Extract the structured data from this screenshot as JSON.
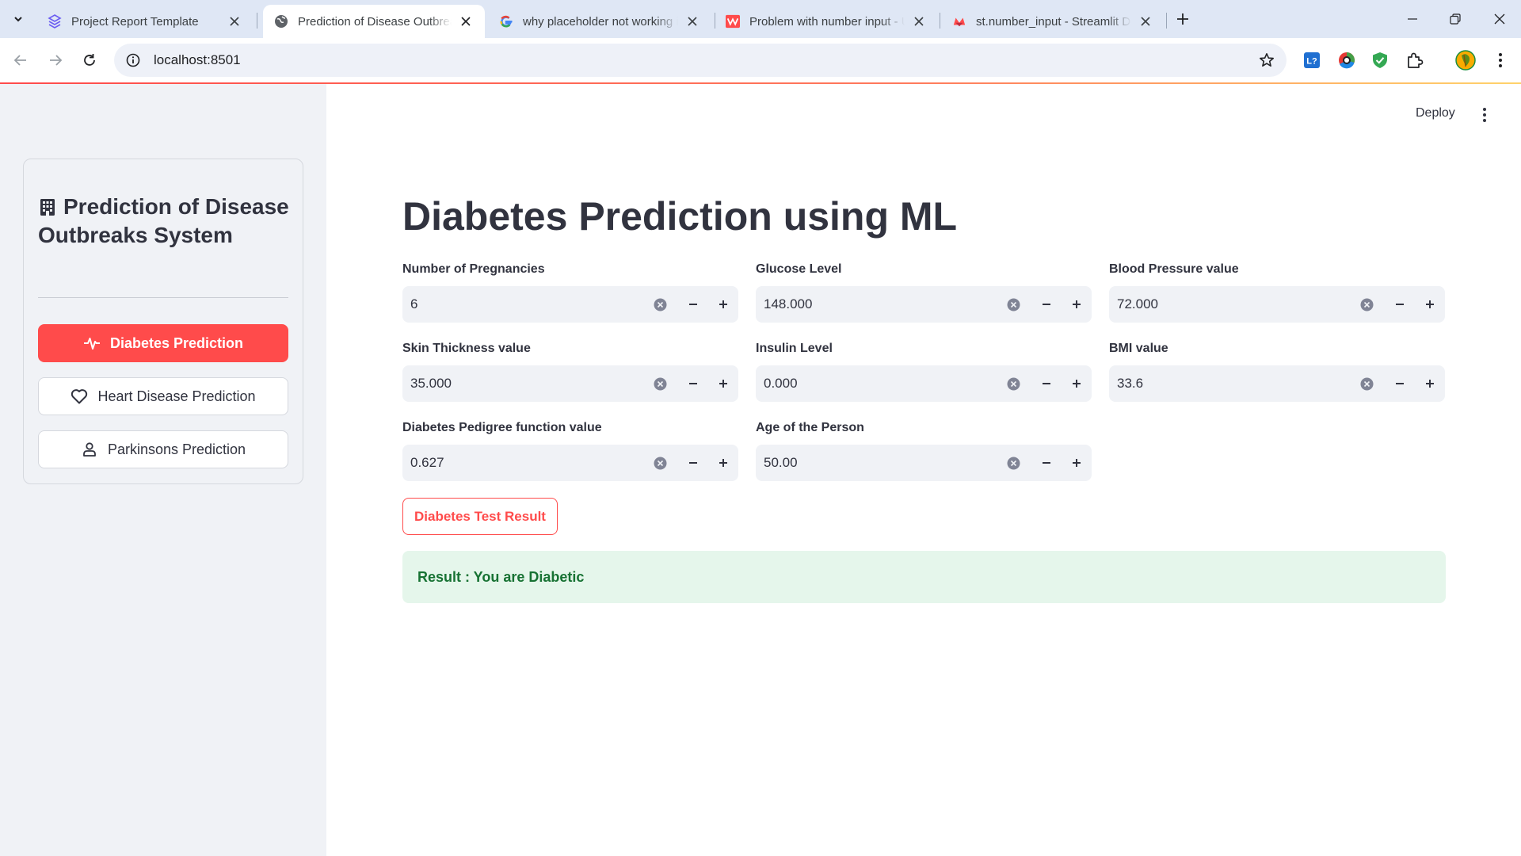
{
  "browser": {
    "tabs": [
      {
        "title": "Project Report Template",
        "icon": "stack-icon"
      },
      {
        "title": "Prediction of Disease Outbreaks System",
        "icon": "globe-icon"
      },
      {
        "title": "why placeholder not working in Streamlit",
        "icon": "google-icon"
      },
      {
        "title": "Problem with number input - Using Streamlit",
        "icon": "streamlit-icon"
      },
      {
        "title": "st.number_input - Streamlit Docs",
        "icon": "streamlit-icon"
      }
    ],
    "active_tab_index": 1,
    "url": "localhost:8501"
  },
  "app": {
    "header": {
      "deploy_label": "Deploy"
    },
    "sidebar": {
      "title": "Prediction of Disease Outbreaks System",
      "title_icon": "hospital-building-icon",
      "menu": [
        {
          "label": "Diabetes Prediction",
          "icon": "activity-icon",
          "selected": true
        },
        {
          "label": "Heart Disease Prediction",
          "icon": "heart-icon",
          "selected": false
        },
        {
          "label": "Parkinsons Prediction",
          "icon": "person-icon",
          "selected": false
        }
      ]
    },
    "page_title": "Diabetes Prediction using ML",
    "fields": [
      {
        "label": "Number of Pregnancies",
        "value": "6"
      },
      {
        "label": "Glucose Level",
        "value": "148.000"
      },
      {
        "label": "Blood Pressure value",
        "value": "72.000"
      },
      {
        "label": "Skin Thickness value",
        "value": "35.000"
      },
      {
        "label": "Insulin Level",
        "value": "0.000"
      },
      {
        "label": "BMI value",
        "value": "33.6"
      },
      {
        "label": "Diabetes Pedigree function value",
        "value": "0.627"
      },
      {
        "label": "Age of the Person",
        "value": "50.00"
      }
    ],
    "submit_label": "Diabetes Test Result",
    "result_text": "Result : You are Diabetic",
    "colors": {
      "primary": "#ff4b4b",
      "sidebar_bg": "#f0f2f6",
      "success_bg": "#e5f6eb",
      "success_text": "#177233"
    }
  }
}
